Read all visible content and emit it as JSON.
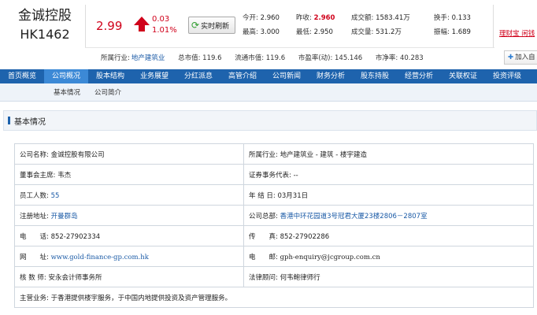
{
  "stock": {
    "name": "金诚控股",
    "code": "HK1462",
    "price": "2.99",
    "change": "0.03",
    "change_pct": "1.01%",
    "refresh_label": "实时刷新"
  },
  "quote": {
    "open_label": "今开:",
    "open": "2.960",
    "prev_close_label": "昨收:",
    "prev_close": "2.960",
    "turnover_label": "成交额:",
    "turnover": "1583.41万",
    "turnover_rate_label": "换手:",
    "turnover_rate": "0.133",
    "high_label": "最高:",
    "high": "3.000",
    "low_label": "最低:",
    "low": "2.950",
    "volume_label": "成交量:",
    "volume": "531.2万",
    "amplitude_label": "振幅:",
    "amplitude": "1.689"
  },
  "info": {
    "industry_label": "所属行业:",
    "industry": "地产建筑业",
    "total_mcap": "总市值: 119.6",
    "float_mcap": "流通市值: 119.6",
    "pe": "市盈率(动): 145.146",
    "pb": "市净率: 40.283"
  },
  "right": {
    "wealth_link": "理财宝 闲钱",
    "fav_label": "加入自"
  },
  "nav": {
    "items": [
      "首页概览",
      "公司概况",
      "股本结构",
      "业务展望",
      "分红派息",
      "高管介绍",
      "公司新闻",
      "财务分析",
      "股东持股",
      "经营分析",
      "关联权证",
      "投资评级"
    ]
  },
  "subnav": {
    "items": [
      "基本情况",
      "公司简介"
    ]
  },
  "section": {
    "title": "基本情况"
  },
  "profile": {
    "company_name": "公司名称: 金诚控股有限公司",
    "industry": "所属行业: 地产建筑业 - 建筑 - 楼宇建造",
    "chairman_label": "董事会主席:",
    "chairman": "韦杰",
    "secretary": "证券事务代表: --",
    "employees_label": "员工人数:",
    "employees": "55",
    "year_end_label": "年 结 日:",
    "year_end": "03月31日",
    "reg_address_label": "注册地址:",
    "reg_address": "开曼群岛",
    "hq_label": "公司总部:",
    "hq": "香港中环花园道3号冠君大厦23楼2806－2807室",
    "phone_label": "电　　话:",
    "phone": "852-27902334",
    "fax_label": "传　　真:",
    "fax": "852-27902286",
    "website_label": "网　　址:",
    "website": "www.gold-finance-gp.com.hk",
    "email_label": "电　　邮:",
    "email": "gph-enquiry@jcgroup.com.cn",
    "auditor_label": "核 数 师:",
    "auditor": "安永会计师事务所",
    "legal_label": "法律顾问:",
    "legal": "何韦鲍律师行",
    "business_label": "主营业务:",
    "business": "于香港提供楼宇服务，于中国内地提供投资及资产管理服务。"
  }
}
